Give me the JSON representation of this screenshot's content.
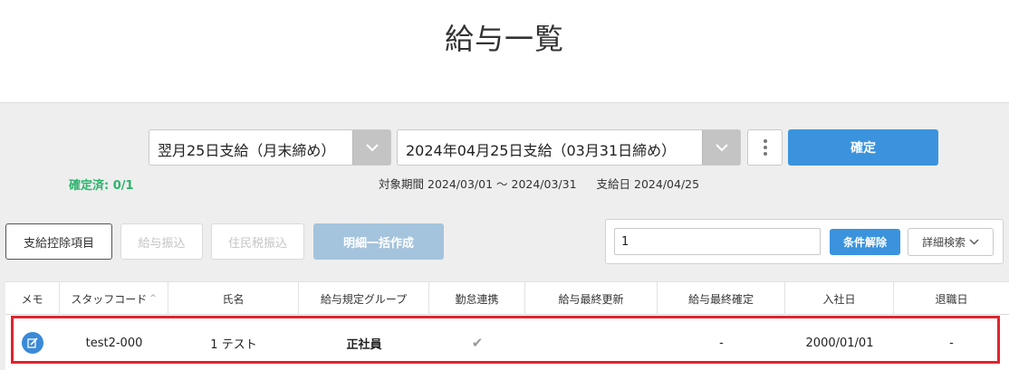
{
  "page": {
    "title": "給与一覧"
  },
  "selectors": {
    "cycle": {
      "value": "翌月25日支給（月末締め）"
    },
    "payday": {
      "value": "2024年04月25日支給（03月31日締め）"
    }
  },
  "confirm_label": "確定",
  "status": {
    "confirmed": "確定済: 0/1"
  },
  "period": {
    "label": "対象期間",
    "range": "2024/03/01 ～ 2024/03/31",
    "payday_label": "支給日",
    "payday": "2024/04/25"
  },
  "toolbar": {
    "items_label": "支給控除項目",
    "salary_transfer_label": "給与振込",
    "tax_transfer_label": "住民税振込",
    "bulk_label": "明細一括作成"
  },
  "filter": {
    "search_value": "1",
    "clear_label": "条件解除",
    "advanced_label": "詳細検索"
  },
  "table": {
    "columns": [
      "メモ",
      "スタッフコード",
      "氏名",
      "給与規定グループ",
      "勤怠連携",
      "給与最終更新",
      "給与最終確定",
      "入社日",
      "退職日"
    ],
    "sort_indicator": "^",
    "rows": [
      {
        "staff_code": "test2-000",
        "name": "1 テスト",
        "group": "正社員",
        "attendance": "✔",
        "last_update": "",
        "last_confirm": "-",
        "hire_date": "2000/01/01",
        "retire_date": "-"
      }
    ]
  },
  "colors": {
    "accent": "#3a93dc",
    "confirmed": "#2bb36b",
    "highlight": "#e0242f"
  }
}
